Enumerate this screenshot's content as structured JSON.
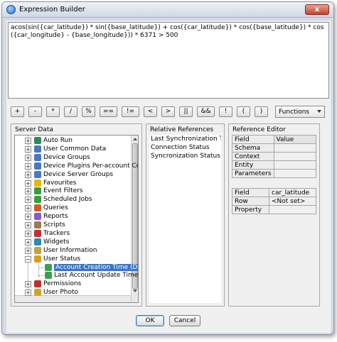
{
  "window": {
    "title": "Expression Builder",
    "close_glyph": "x"
  },
  "expression": {
    "text": "acos(sin({car_latitude}) * sin({base_latitude}) + cos({car_latitude}) * cos({base_latitude}) * cos({car_longitude} - {base_longitude})) * 6371   > 500"
  },
  "operators": [
    "+",
    "-",
    "*",
    "/",
    "%",
    "==",
    "!=",
    "<",
    ">",
    "||",
    "&&",
    "!",
    "(",
    ")"
  ],
  "functions_select": {
    "selected": "Functions"
  },
  "server_data": {
    "title": "Server Data",
    "items": [
      {
        "label": "Auto Run",
        "icon": "auto-run-icon",
        "color": "#2e8b57"
      },
      {
        "label": "User Common Data",
        "icon": "database-icon",
        "color": "#4a78c8"
      },
      {
        "label": "Device Groups",
        "icon": "device-groups-icon",
        "color": "#4a78c8"
      },
      {
        "label": "Device Plugins Per-account Confi",
        "icon": "plugin-icon",
        "color": "#4a78c8"
      },
      {
        "label": "Device Server Groups",
        "icon": "server-groups-icon",
        "color": "#4a78c8"
      },
      {
        "label": "Favourites",
        "icon": "star-icon",
        "color": "#e6b800"
      },
      {
        "label": "Event Filters",
        "icon": "filter-icon",
        "color": "#3a9c3a"
      },
      {
        "label": "Scheduled Jobs",
        "icon": "clock-icon",
        "color": "#3a9c3a"
      },
      {
        "label": "Queries",
        "icon": "query-icon",
        "color": "#d05a2a"
      },
      {
        "label": "Reports",
        "icon": "report-icon",
        "color": "#8a5ac8"
      },
      {
        "label": "Scripts",
        "icon": "script-icon",
        "color": "#a07850"
      },
      {
        "label": "Trackers",
        "icon": "tracker-icon",
        "color": "#c03030"
      },
      {
        "label": "Widgets",
        "icon": "widget-icon",
        "color": "#2a8ab8"
      },
      {
        "label": "User Information",
        "icon": "user-info-icon",
        "color": "#c8a040"
      },
      {
        "label": "User Status",
        "icon": "variable-icon",
        "color": "#d8a020",
        "expanded": true
      },
      {
        "label": "Account Creation Time (Date",
        "icon": "field-icon",
        "color": "#3aa050",
        "child": true,
        "selected": true
      },
      {
        "label": "Last Account Update Time (D",
        "icon": "field-icon",
        "color": "#3aa050",
        "child": true
      },
      {
        "label": "Permissions",
        "icon": "permissions-icon",
        "color": "#c03030"
      },
      {
        "label": "User Photo",
        "icon": "variable-icon",
        "color": "#d8a020"
      }
    ]
  },
  "relative_references": {
    "title": "Relative References",
    "items": [
      "Last Synchronization Time",
      "Connection Status",
      "Syncronization Status"
    ]
  },
  "reference_editor": {
    "title": "Reference Editor",
    "headers": [
      "Field",
      "Value"
    ],
    "rows1": [
      {
        "field": "Schema",
        "value": ""
      },
      {
        "field": "Context",
        "value": ""
      },
      {
        "field": "Entity",
        "value": ""
      },
      {
        "field": "Parameters",
        "value": ""
      }
    ],
    "rows2": [
      {
        "field": "Field",
        "value": "car_latitude"
      },
      {
        "field": "Row",
        "value": "<Not set>"
      },
      {
        "field": "Property",
        "value": ""
      }
    ]
  },
  "buttons": {
    "ok": "OK",
    "cancel": "Cancel"
  }
}
